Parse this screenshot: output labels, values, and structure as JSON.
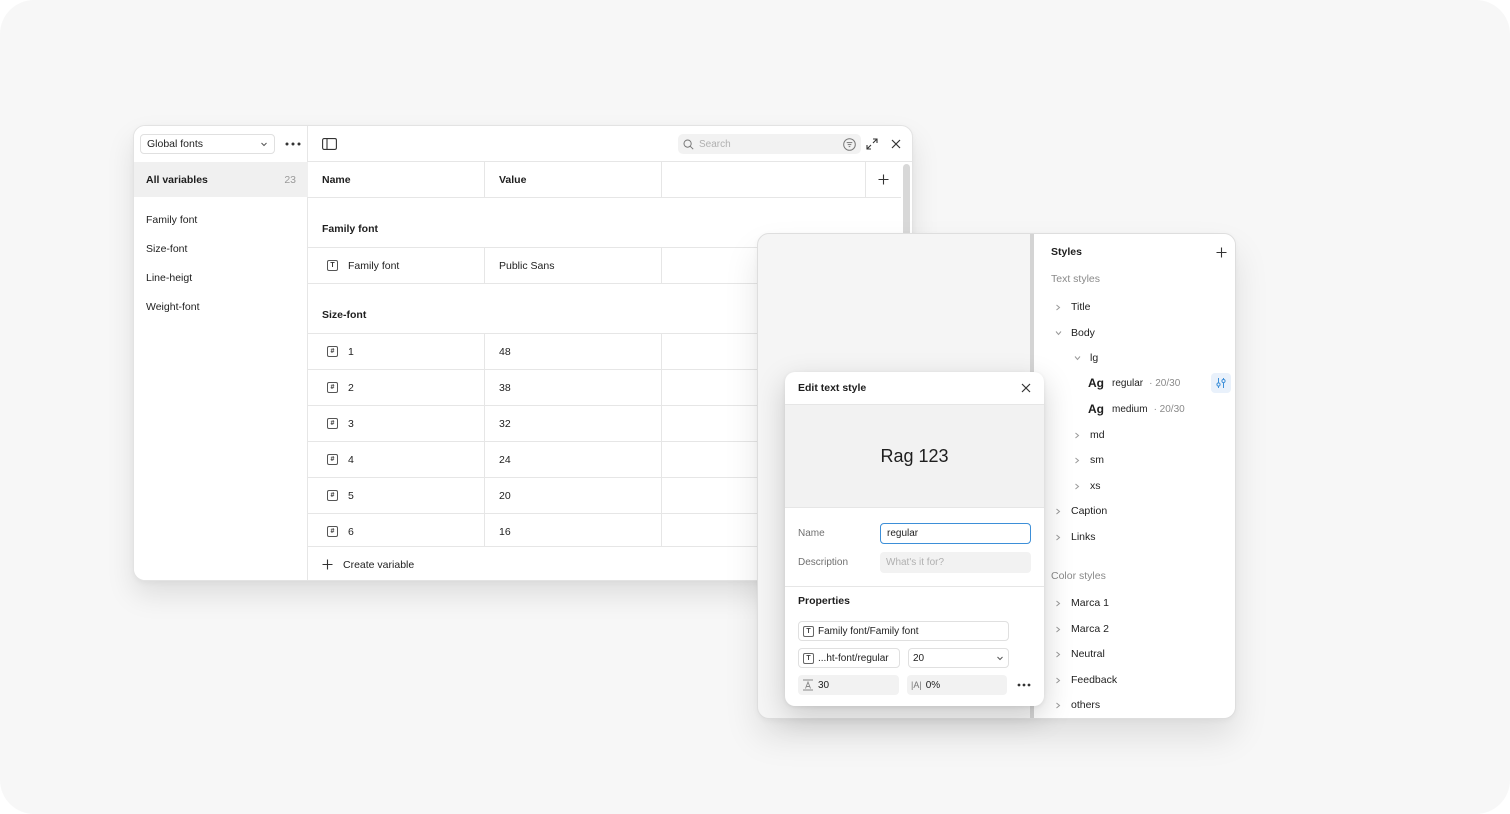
{
  "variables_window": {
    "collection": "Global fonts",
    "all_variables_label": "All variables",
    "all_variables_count": "23",
    "groups": [
      "Family font",
      "Size-font",
      "Line-heigt",
      "Weight-font"
    ],
    "search_placeholder": "Search",
    "columns": {
      "name": "Name",
      "value": "Value"
    },
    "sections": [
      {
        "title": "Family font",
        "rows": [
          {
            "icon": "T",
            "name": "Family font",
            "value": "Public Sans"
          }
        ]
      },
      {
        "title": "Size-font",
        "rows": [
          {
            "icon": "#",
            "name": "1",
            "value": "48"
          },
          {
            "icon": "#",
            "name": "2",
            "value": "38"
          },
          {
            "icon": "#",
            "name": "3",
            "value": "32"
          },
          {
            "icon": "#",
            "name": "4",
            "value": "24"
          },
          {
            "icon": "#",
            "name": "5",
            "value": "20"
          },
          {
            "icon": "#",
            "name": "6",
            "value": "16"
          }
        ]
      }
    ],
    "create_label": "Create variable"
  },
  "styles_panel": {
    "title": "Styles",
    "text_styles_label": "Text styles",
    "color_styles_label": "Color styles",
    "text_tree": {
      "title": "Title",
      "body": "Body",
      "lg": "lg",
      "regular": {
        "ag": "Ag",
        "name": "regular",
        "meta": "· 20/30"
      },
      "medium": {
        "ag": "Ag",
        "name": "medium",
        "meta": "· 20/30"
      },
      "md": "md",
      "sm": "sm",
      "xs": "xs",
      "caption": "Caption",
      "links": "Links"
    },
    "color_items": [
      "Marca 1",
      "Marca 2",
      "Neutral",
      "Feedback",
      "others"
    ]
  },
  "edit_popover": {
    "title": "Edit text style",
    "preview": "Rag 123",
    "name_label": "Name",
    "name_value": "regular",
    "description_label": "Description",
    "description_placeholder": "What's it for?",
    "properties_label": "Properties",
    "font_family": "Family font/Family font",
    "font_weight": "...ht-font/regular",
    "font_size": "20",
    "line_height": "30",
    "letter_spacing": "0%",
    "letter_spacing_icon": "|A|"
  },
  "colors": {
    "accent": "#3d8fd8",
    "canvas": "#f7f7f7"
  }
}
